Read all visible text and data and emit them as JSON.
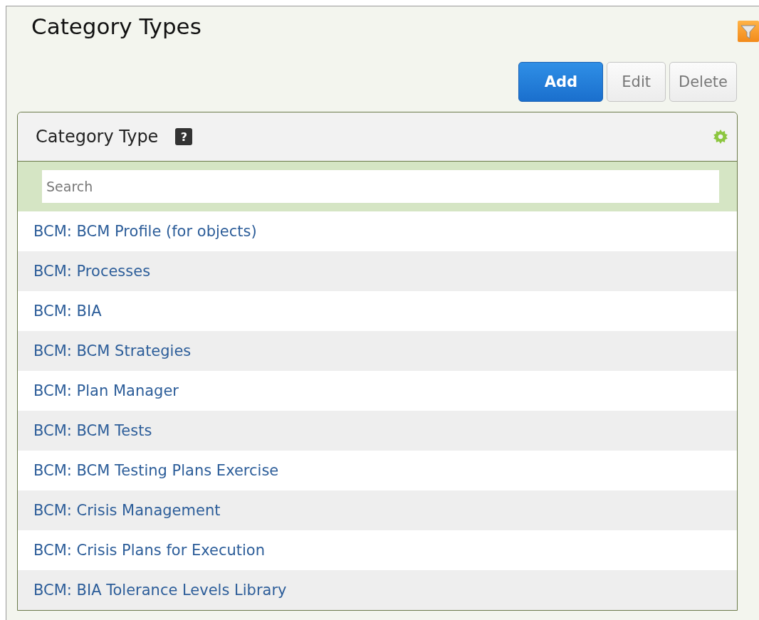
{
  "page": {
    "title": "Category Types"
  },
  "buttons": [
    {
      "label": "Add",
      "kind": "primary"
    },
    {
      "label": "Edit",
      "kind": "secondary"
    },
    {
      "label": "Delete",
      "kind": "secondary"
    }
  ],
  "panel": {
    "title": "Category Type",
    "help": "?",
    "search": {
      "placeholder": "Search"
    },
    "rows": [
      "BCM: BCM Profile (for objects)",
      "BCM: Processes",
      "BCM: BIA",
      "BCM: BCM Strategies",
      "BCM: Plan Manager",
      "BCM: BCM Tests",
      "BCM: BCM Testing Plans Exercise",
      "BCM: Crisis Management",
      "BCM: Crisis Plans for Execution",
      "BCM: BIA Tolerance Levels Library"
    ]
  }
}
